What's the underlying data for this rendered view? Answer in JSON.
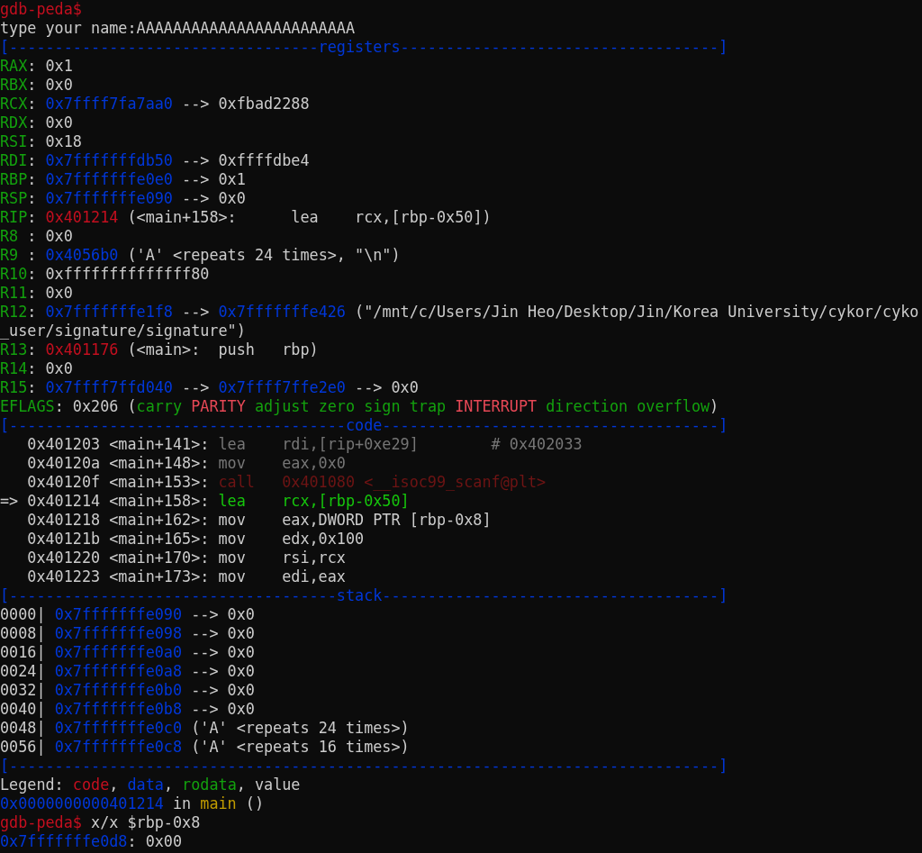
{
  "terminal": {
    "lines": [
      {
        "segments": [
          {
            "text": "gdb-peda$",
            "color": "#c50f1f"
          }
        ]
      },
      {
        "segments": [
          {
            "text": "type your name:AAAAAAAAAAAAAAAAAAAAAAAA",
            "color": "#cccccc"
          }
        ]
      },
      {
        "segments": [
          {
            "text": "[----------------------------------registers-----------------------------------]",
            "color": "#0037da"
          }
        ]
      },
      {
        "segments": [
          {
            "text": "RAX",
            "color": "#13a10e"
          },
          {
            "text": ": 0x1",
            "color": "#cccccc"
          }
        ]
      },
      {
        "segments": [
          {
            "text": "RBX",
            "color": "#13a10e"
          },
          {
            "text": ": 0x0",
            "color": "#cccccc"
          }
        ]
      },
      {
        "segments": [
          {
            "text": "RCX",
            "color": "#13a10e"
          },
          {
            "text": ": ",
            "color": "#cccccc"
          },
          {
            "text": "0x7ffff7fa7aa0",
            "color": "#0037da"
          },
          {
            "text": " --> 0xfbad2288",
            "color": "#cccccc"
          }
        ]
      },
      {
        "segments": [
          {
            "text": "RDX",
            "color": "#13a10e"
          },
          {
            "text": ": 0x0",
            "color": "#cccccc"
          }
        ]
      },
      {
        "segments": [
          {
            "text": "RSI",
            "color": "#13a10e"
          },
          {
            "text": ": 0x18",
            "color": "#cccccc"
          }
        ]
      },
      {
        "segments": [
          {
            "text": "RDI",
            "color": "#13a10e"
          },
          {
            "text": ": ",
            "color": "#cccccc"
          },
          {
            "text": "0x7fffffffdb50",
            "color": "#0037da"
          },
          {
            "text": " --> 0xffffdbe4",
            "color": "#cccccc"
          }
        ]
      },
      {
        "segments": [
          {
            "text": "RBP",
            "color": "#13a10e"
          },
          {
            "text": ": ",
            "color": "#cccccc"
          },
          {
            "text": "0x7fffffffe0e0",
            "color": "#0037da"
          },
          {
            "text": " --> 0x1",
            "color": "#cccccc"
          }
        ]
      },
      {
        "segments": [
          {
            "text": "RSP",
            "color": "#13a10e"
          },
          {
            "text": ": ",
            "color": "#cccccc"
          },
          {
            "text": "0x7fffffffe090",
            "color": "#0037da"
          },
          {
            "text": " --> 0x0",
            "color": "#cccccc"
          }
        ]
      },
      {
        "segments": [
          {
            "text": "RIP",
            "color": "#13a10e"
          },
          {
            "text": ": ",
            "color": "#cccccc"
          },
          {
            "text": "0x401214",
            "color": "#c50f1f"
          },
          {
            "text": " (<main+158>:      lea    rcx,[rbp-0x50])",
            "color": "#cccccc"
          }
        ]
      },
      {
        "segments": [
          {
            "text": "R8 ",
            "color": "#13a10e"
          },
          {
            "text": ": 0x0",
            "color": "#cccccc"
          }
        ]
      },
      {
        "segments": [
          {
            "text": "R9 ",
            "color": "#13a10e"
          },
          {
            "text": ": ",
            "color": "#cccccc"
          },
          {
            "text": "0x4056b0",
            "color": "#0037da"
          },
          {
            "text": " ('A' <repeats 24 times>, \"\\n\")",
            "color": "#cccccc"
          }
        ]
      },
      {
        "segments": [
          {
            "text": "R10",
            "color": "#13a10e"
          },
          {
            "text": ": 0xffffffffffffff80",
            "color": "#cccccc"
          }
        ]
      },
      {
        "segments": [
          {
            "text": "R11",
            "color": "#13a10e"
          },
          {
            "text": ": 0x0",
            "color": "#cccccc"
          }
        ]
      },
      {
        "segments": [
          {
            "text": "R12",
            "color": "#13a10e"
          },
          {
            "text": ": ",
            "color": "#cccccc"
          },
          {
            "text": "0x7fffffffe1f8",
            "color": "#0037da"
          },
          {
            "text": " --> ",
            "color": "#cccccc"
          },
          {
            "text": "0x7fffffffe426",
            "color": "#0037da"
          },
          {
            "text": " (\"/mnt/c/Users/Jin Heo/Desktop/Jin/Korea University/cykor/cyko",
            "color": "#cccccc"
          }
        ]
      },
      {
        "segments": [
          {
            "text": "_user/signature/signature\")",
            "color": "#cccccc"
          }
        ]
      },
      {
        "segments": [
          {
            "text": "R13",
            "color": "#13a10e"
          },
          {
            "text": ": ",
            "color": "#cccccc"
          },
          {
            "text": "0x401176",
            "color": "#c50f1f"
          },
          {
            "text": " (<main>:  push   rbp)",
            "color": "#cccccc"
          }
        ]
      },
      {
        "segments": [
          {
            "text": "R14",
            "color": "#13a10e"
          },
          {
            "text": ": 0x0",
            "color": "#cccccc"
          }
        ]
      },
      {
        "segments": [
          {
            "text": "R15",
            "color": "#13a10e"
          },
          {
            "text": ": ",
            "color": "#cccccc"
          },
          {
            "text": "0x7ffff7ffd040",
            "color": "#0037da"
          },
          {
            "text": " --> ",
            "color": "#cccccc"
          },
          {
            "text": "0x7ffff7ffe2e0",
            "color": "#0037da"
          },
          {
            "text": " --> 0x0",
            "color": "#cccccc"
          }
        ]
      },
      {
        "segments": [
          {
            "text": "EFLAGS",
            "color": "#13a10e"
          },
          {
            "text": ": 0x206 (",
            "color": "#cccccc"
          },
          {
            "text": "carry ",
            "color": "#13a10e"
          },
          {
            "text": "PARITY",
            "color": "#e74856"
          },
          {
            "text": " adjust zero sign trap ",
            "color": "#13a10e"
          },
          {
            "text": "INTERRUPT",
            "color": "#e74856"
          },
          {
            "text": " direction overflow",
            "color": "#13a10e"
          },
          {
            "text": ")",
            "color": "#cccccc"
          }
        ]
      },
      {
        "segments": [
          {
            "text": "[-------------------------------------code-------------------------------------]",
            "color": "#0037da"
          }
        ]
      },
      {
        "segments": [
          {
            "text": "   0x401203 <main+141>: ",
            "color": "#cccccc"
          },
          {
            "text": "lea    rdi,[rip+0xe29]        # 0x402033",
            "color": "#767676"
          }
        ]
      },
      {
        "segments": [
          {
            "text": "   0x40120a <main+148>: ",
            "color": "#cccccc"
          },
          {
            "text": "mov    eax,0x0",
            "color": "#767676"
          }
        ]
      },
      {
        "segments": [
          {
            "text": "   0x40120f <main+153>: ",
            "color": "#cccccc"
          },
          {
            "text": "call   0x401080 <__isoc99_scanf@plt>",
            "color": "#6e1414"
          }
        ]
      },
      {
        "segments": [
          {
            "text": "=> 0x401214 <main+158>: ",
            "color": "#cccccc"
          },
          {
            "text": "lea    rcx,[rbp-0x50]",
            "color": "#16c60c"
          }
        ]
      },
      {
        "segments": [
          {
            "text": "   0x401218 <main+162>: mov    eax,DWORD PTR [rbp-0x8]",
            "color": "#cccccc"
          }
        ]
      },
      {
        "segments": [
          {
            "text": "   0x40121b <main+165>: mov    edx,0x100",
            "color": "#cccccc"
          }
        ]
      },
      {
        "segments": [
          {
            "text": "   0x401220 <main+170>: mov    rsi,rcx",
            "color": "#cccccc"
          }
        ]
      },
      {
        "segments": [
          {
            "text": "   0x401223 <main+173>: mov    edi,eax",
            "color": "#cccccc"
          }
        ]
      },
      {
        "segments": [
          {
            "text": "[------------------------------------stack-------------------------------------]",
            "color": "#0037da"
          }
        ]
      },
      {
        "segments": [
          {
            "text": "0000| ",
            "color": "#cccccc"
          },
          {
            "text": "0x7fffffffe090",
            "color": "#0037da"
          },
          {
            "text": " --> 0x0",
            "color": "#cccccc"
          }
        ]
      },
      {
        "segments": [
          {
            "text": "0008| ",
            "color": "#cccccc"
          },
          {
            "text": "0x7fffffffe098",
            "color": "#0037da"
          },
          {
            "text": " --> 0x0",
            "color": "#cccccc"
          }
        ]
      },
      {
        "segments": [
          {
            "text": "0016| ",
            "color": "#cccccc"
          },
          {
            "text": "0x7fffffffe0a0",
            "color": "#0037da"
          },
          {
            "text": " --> 0x0",
            "color": "#cccccc"
          }
        ]
      },
      {
        "segments": [
          {
            "text": "0024| ",
            "color": "#cccccc"
          },
          {
            "text": "0x7fffffffe0a8",
            "color": "#0037da"
          },
          {
            "text": " --> 0x0",
            "color": "#cccccc"
          }
        ]
      },
      {
        "segments": [
          {
            "text": "0032| ",
            "color": "#cccccc"
          },
          {
            "text": "0x7fffffffe0b0",
            "color": "#0037da"
          },
          {
            "text": " --> 0x0",
            "color": "#cccccc"
          }
        ]
      },
      {
        "segments": [
          {
            "text": "0040| ",
            "color": "#cccccc"
          },
          {
            "text": "0x7fffffffe0b8",
            "color": "#0037da"
          },
          {
            "text": " --> 0x0",
            "color": "#cccccc"
          }
        ]
      },
      {
        "segments": [
          {
            "text": "0048| ",
            "color": "#cccccc"
          },
          {
            "text": "0x7fffffffe0c0",
            "color": "#0037da"
          },
          {
            "text": " ('A' <repeats 24 times>)",
            "color": "#cccccc"
          }
        ]
      },
      {
        "segments": [
          {
            "text": "0056| ",
            "color": "#cccccc"
          },
          {
            "text": "0x7fffffffe0c8",
            "color": "#0037da"
          },
          {
            "text": " ('A' <repeats 16 times>)",
            "color": "#cccccc"
          }
        ]
      },
      {
        "segments": [
          {
            "text": "[------------------------------------------------------------------------------]",
            "color": "#0037da"
          }
        ]
      },
      {
        "segments": [
          {
            "text": "Legend: ",
            "color": "#cccccc"
          },
          {
            "text": "code",
            "color": "#c50f1f"
          },
          {
            "text": ", ",
            "color": "#cccccc"
          },
          {
            "text": "data",
            "color": "#0037da"
          },
          {
            "text": ", ",
            "color": "#cccccc"
          },
          {
            "text": "rodata",
            "color": "#13a10e"
          },
          {
            "text": ", value",
            "color": "#cccccc"
          }
        ]
      },
      {
        "segments": [
          {
            "text": "0x0000000000401214",
            "color": "#0037da"
          },
          {
            "text": " in ",
            "color": "#cccccc"
          },
          {
            "text": "main",
            "color": "#c19c00"
          },
          {
            "text": " ()",
            "color": "#cccccc"
          }
        ]
      },
      {
        "segments": [
          {
            "text": "gdb-peda$",
            "color": "#c50f1f"
          },
          {
            "text": " x/x $rbp-0x8",
            "color": "#cccccc"
          }
        ]
      },
      {
        "segments": [
          {
            "text": "0x7fffffffe0d8",
            "color": "#0037da"
          },
          {
            "text": ": 0x00",
            "color": "#cccccc"
          }
        ]
      }
    ]
  }
}
